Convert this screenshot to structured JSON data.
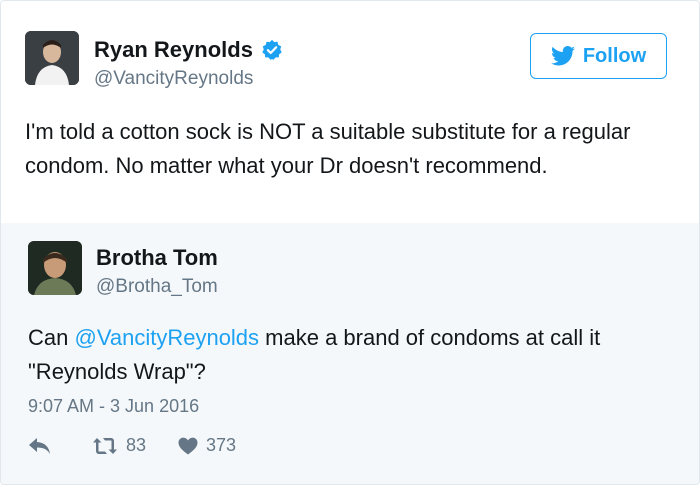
{
  "tweet": {
    "author": {
      "name": "Ryan Reynolds",
      "handle": "@VancityReynolds",
      "verified": true,
      "avatar_icon": "profile-photo"
    },
    "follow_label": "Follow",
    "text": "I'm told a cotton sock is NOT a suitable substitute for a regular condom. No matter what your Dr doesn't recommend."
  },
  "reply": {
    "author": {
      "name": "Brotha Tom",
      "handle": "@Brotha_Tom",
      "avatar_icon": "profile-photo"
    },
    "text_prefix": "Can ",
    "mention": "@VancityReynolds",
    "text_suffix": " make a brand of condoms at call it \"Reynolds Wrap\"?",
    "timestamp": "9:07 AM - 3 Jun 2016",
    "retweets": "83",
    "likes": "373"
  },
  "colors": {
    "brand": "#1da1f2",
    "muted": "#657786",
    "reply_bg": "#f5f8fa"
  }
}
